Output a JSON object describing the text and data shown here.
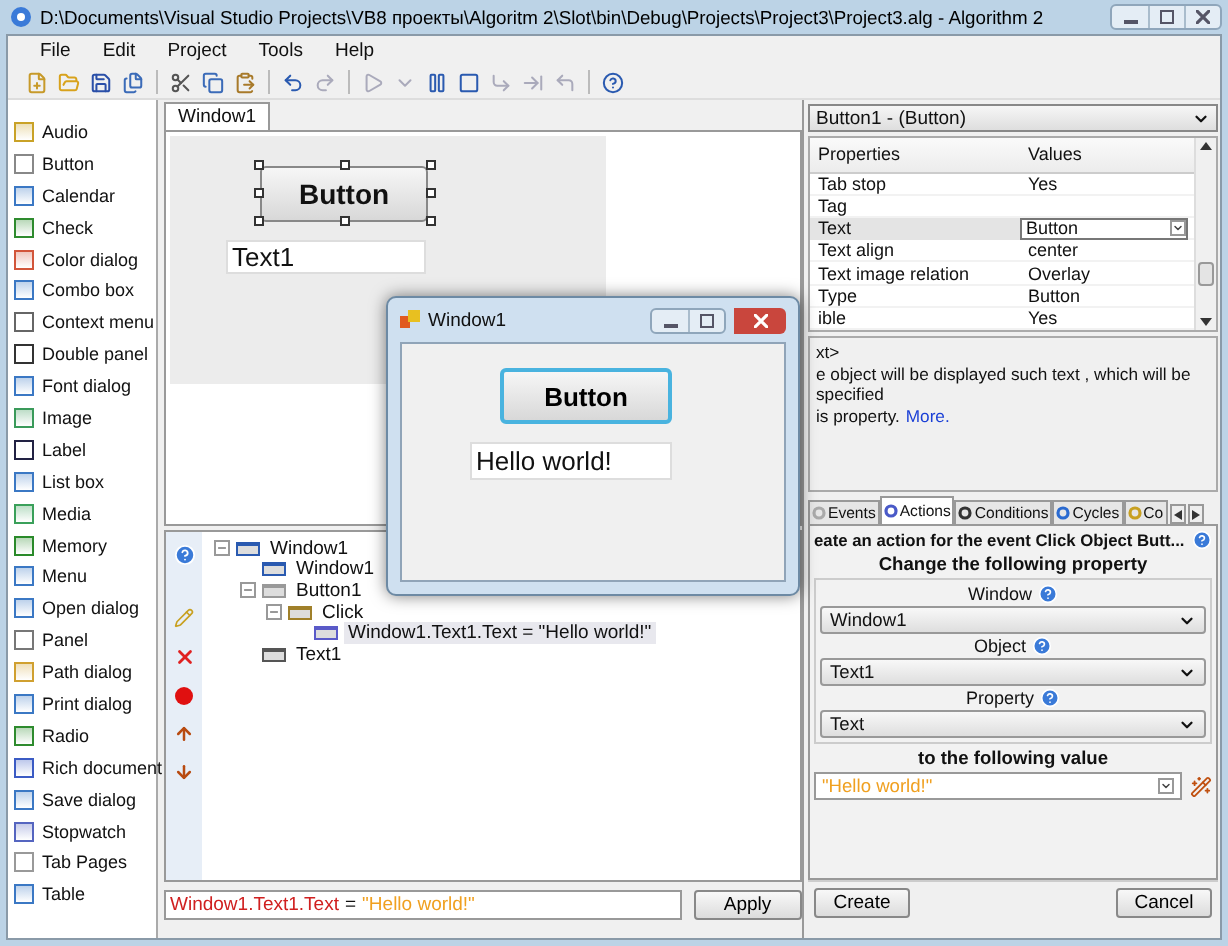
{
  "window": {
    "title": "D:\\Documents\\Visual Studio Projects\\VB8 проекты\\Algoritm 2\\Slot\\bin\\Debug\\Projects\\Project3\\Project3.alg - Algorithm 2"
  },
  "menu": [
    "File",
    "Edit",
    "Project",
    "Tools",
    "Help"
  ],
  "toolbar": [
    {
      "kind": "new",
      "disabled": false
    },
    {
      "kind": "open",
      "disabled": false
    },
    {
      "kind": "save",
      "disabled": false
    },
    {
      "kind": "save-all",
      "disabled": false
    },
    {
      "kind": "sep"
    },
    {
      "kind": "cut",
      "disabled": false
    },
    {
      "kind": "copy",
      "disabled": false
    },
    {
      "kind": "paste",
      "disabled": false
    },
    {
      "kind": "sep"
    },
    {
      "kind": "undo",
      "disabled": false
    },
    {
      "kind": "redo",
      "disabled": true
    },
    {
      "kind": "sep"
    },
    {
      "kind": "run",
      "disabled": true
    },
    {
      "kind": "dropdown",
      "disabled": true
    },
    {
      "kind": "pause",
      "disabled": false
    },
    {
      "kind": "stop",
      "disabled": false
    },
    {
      "kind": "step-into",
      "disabled": true
    },
    {
      "kind": "step-over",
      "disabled": true
    },
    {
      "kind": "step-out",
      "disabled": true
    },
    {
      "kind": "sep"
    },
    {
      "kind": "help",
      "disabled": false
    }
  ],
  "toolbox": [
    "Audio",
    "Button",
    "Calendar",
    "Check",
    "Color dialog",
    "Combo box",
    "Context menu",
    "Double panel",
    "Font dialog",
    "Image",
    "Label",
    "List box",
    "Media",
    "Memory",
    "Menu",
    "Open dialog",
    "Panel",
    "Path dialog",
    "Print dialog",
    "Radio",
    "Rich document",
    "Save dialog",
    "Stopwatch",
    "Tab Pages",
    "Table"
  ],
  "designer": {
    "tab": {
      "label": "Window1",
      "selected": true
    },
    "button": "Button",
    "text_field": "Text1"
  },
  "tree": [
    {
      "label": "Window1",
      "kind": "window",
      "expanded": true,
      "selected": false,
      "children": [
        {
          "label": "Window1",
          "kind": "window",
          "selected": false
        },
        {
          "label": "Button1",
          "kind": "button",
          "expanded": true,
          "selected": false,
          "children": [
            {
              "label": "Click",
              "kind": "event",
              "expanded": true,
              "selected": false,
              "children": [
                {
                  "label": "Window1.Text1.Text = \"Hello world!\"",
                  "kind": "action",
                  "selected": true
                }
              ]
            }
          ]
        },
        {
          "label": "Text1",
          "kind": "text",
          "selected": false
        }
      ]
    }
  ],
  "expression": {
    "target": "Window1.Text1.Text",
    "operator": "=",
    "value": "\"Hello world!\""
  },
  "apply_button": "Apply",
  "properties": {
    "object": "Button1 - (Button)",
    "columns": [
      "Properties",
      "Values"
    ],
    "rows": [
      {
        "name": "Tab stop",
        "value": "Yes",
        "selected": false
      },
      {
        "name": "Tag",
        "selected": false
      },
      {
        "name": "Text",
        "value": "Button",
        "selected": true
      },
      {
        "name": "Text align",
        "value": "center",
        "selected": false
      },
      {
        "name": "Text image relation",
        "value": "Overlay",
        "selected": false
      },
      {
        "name": "Type",
        "value": "Button",
        "selected": false
      },
      {
        "name": "ible",
        "value": "Yes",
        "selected": false
      }
    ]
  },
  "description": {
    "title": "xt>",
    "lines": [
      "e object will be displayed such text , which will be specified",
      "is property."
    ],
    "link": "More."
  },
  "event_tabs": [
    {
      "label": "Events",
      "kind": "events",
      "selected": false
    },
    {
      "label": "Actions",
      "kind": "actions",
      "selected": true
    },
    {
      "label": "Conditions",
      "kind": "conditions",
      "selected": false
    },
    {
      "label": "Cycles",
      "kind": "cycles",
      "selected": false
    },
    {
      "label": "Co",
      "kind": "comments",
      "selected": false
    }
  ],
  "action": {
    "heading": "eate an action for the event Click Object Butt...",
    "subheading": "Change the following property",
    "fields": [
      {
        "label": "Window",
        "value": "Window1"
      },
      {
        "label": "Object",
        "value": "Text1"
      },
      {
        "label": "Property",
        "value": "Text"
      }
    ],
    "value_heading": "to the following value",
    "value": "\"Hello world!\""
  },
  "buttons": [
    "Create",
    "Cancel"
  ],
  "dialog": {
    "title": "Window1",
    "button": "Button",
    "text": "Hello world!"
  }
}
